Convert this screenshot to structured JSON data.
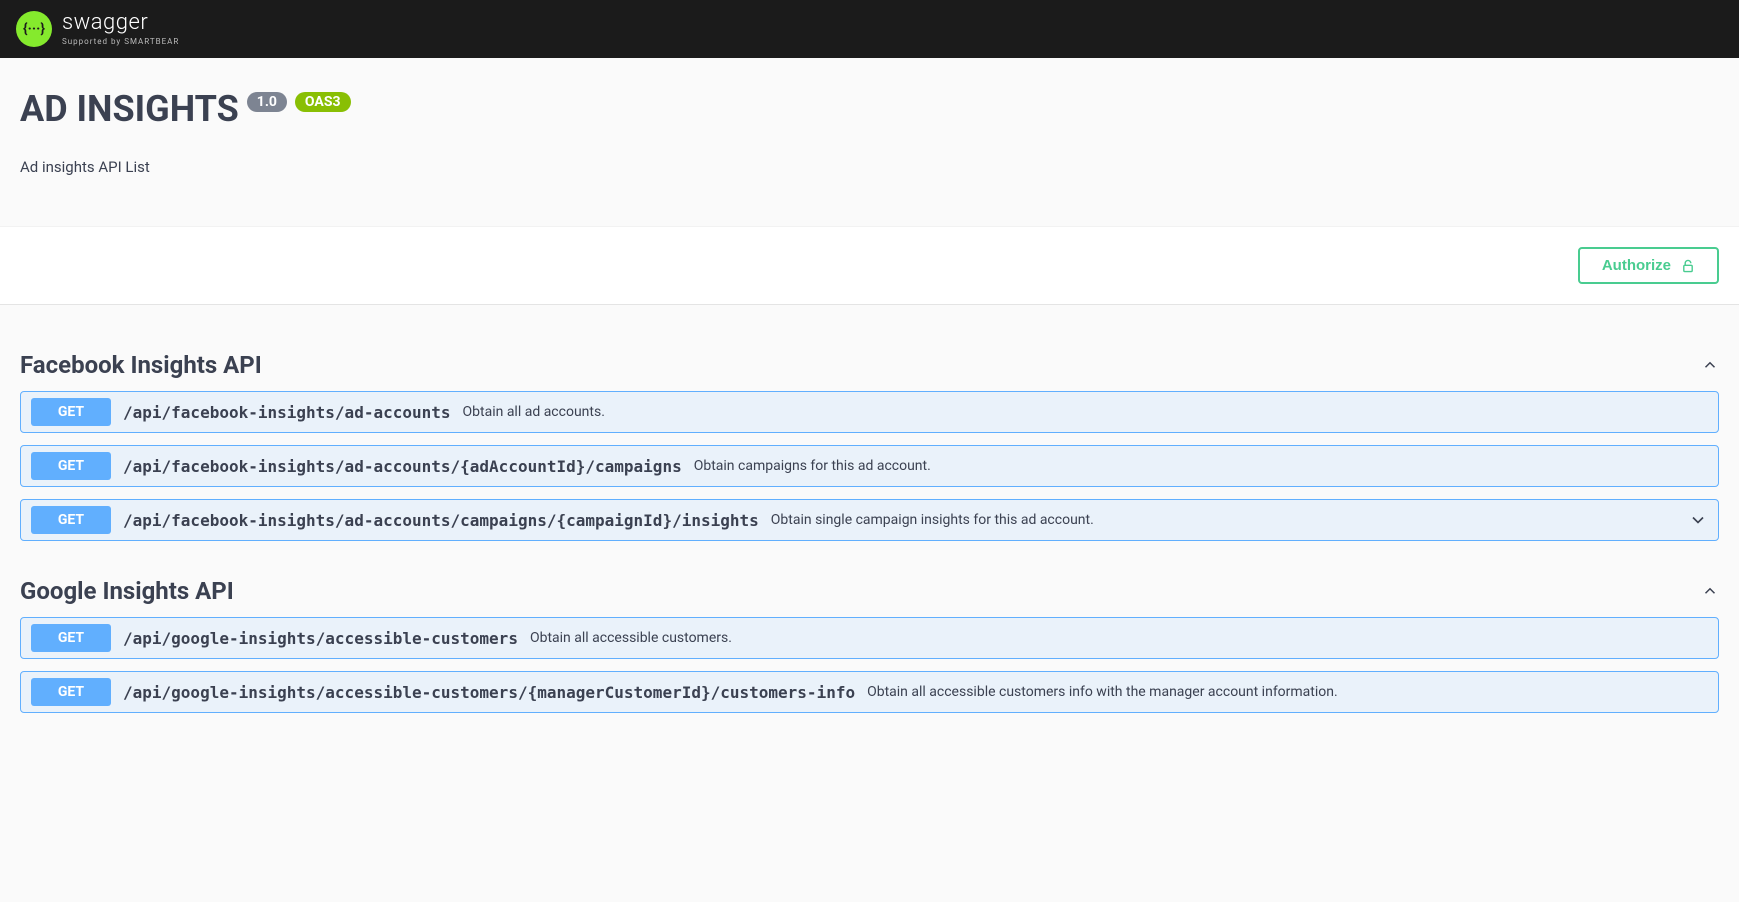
{
  "topbar": {
    "logo_text": "swagger",
    "logo_sub": "Supported by SMARTBEAR",
    "logo_glyph": "{···}"
  },
  "info": {
    "title": "AD INSIGHTS",
    "version": "1.0",
    "oas": "OAS3",
    "description": "Ad insights API List"
  },
  "auth": {
    "authorize_label": "Authorize"
  },
  "tags": [
    {
      "name": "Facebook Insights API",
      "operations": [
        {
          "method": "GET",
          "path": "/api/facebook-insights/ad-accounts",
          "summary": "Obtain all ad accounts."
        },
        {
          "method": "GET",
          "path": "/api/facebook-insights/ad-accounts/{adAccountId}/campaigns",
          "summary": "Obtain campaigns for this ad account."
        },
        {
          "method": "GET",
          "path": "/api/facebook-insights/ad-accounts/campaigns/{campaignId}/insights",
          "summary": "Obtain single campaign insights for this ad account."
        }
      ]
    },
    {
      "name": "Google Insights API",
      "operations": [
        {
          "method": "GET",
          "path": "/api/google-insights/accessible-customers",
          "summary": "Obtain all accessible customers."
        },
        {
          "method": "GET",
          "path": "/api/google-insights/accessible-customers/{managerCustomerId}/customers-info",
          "summary": "Obtain all accessible customers info with the manager account information."
        }
      ]
    }
  ]
}
